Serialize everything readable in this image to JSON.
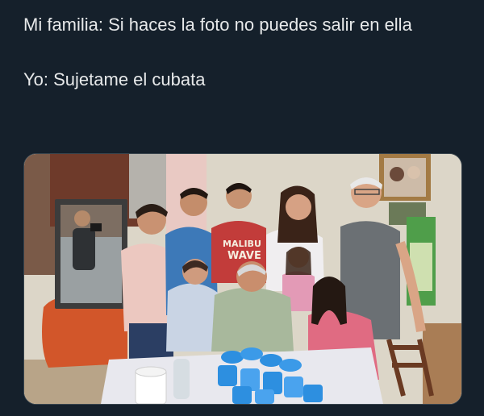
{
  "tweet": {
    "line1": "Mi familia: Si haces la foto no puedes salir en ella",
    "line2": "Yo: Sujetame el cubata"
  },
  "photo": {
    "shirt_text_line1": "MALIBU",
    "shirt_text_line2": "WAVE",
    "colors": {
      "wall": "#dcd6c8",
      "door": "#6e3a2a",
      "couch": "#d2562a",
      "tablecloth": "#e8e8ee",
      "cups": "#2d8fe0"
    }
  }
}
